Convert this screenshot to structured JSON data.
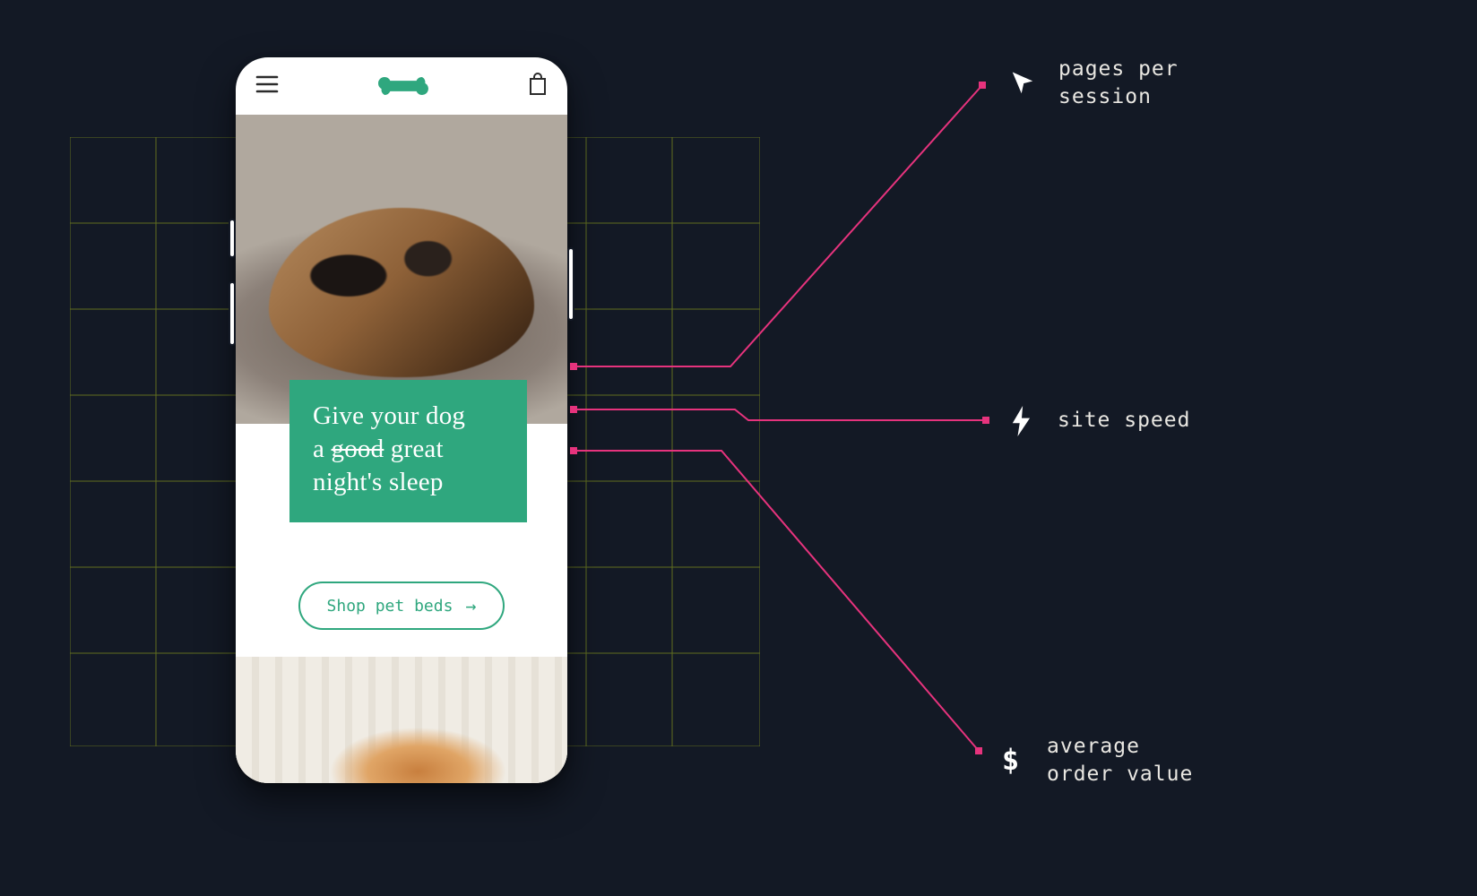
{
  "phone": {
    "hero_headline_l1": "Give your dog",
    "hero_headline_l2_pre": "a ",
    "hero_headline_l2_strike": "good",
    "hero_headline_l2_post": " great",
    "hero_headline_l3": "night's sleep",
    "cta_label": "Shop pet beds"
  },
  "metrics": {
    "pages_per_session": "pages per\nsession",
    "site_speed": "site speed",
    "average_order_value": "average\norder value"
  },
  "colors": {
    "brand_green": "#2fa77e",
    "connector_pink": "#e6337d",
    "grid_olive": "#7a8a1f",
    "bg": "#131925"
  }
}
